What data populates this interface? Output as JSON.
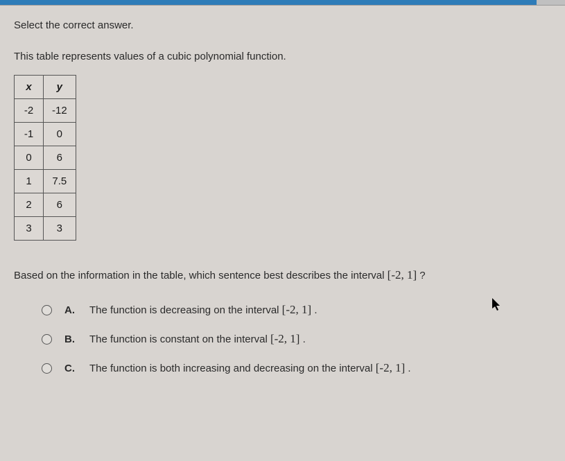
{
  "instruction": "Select the correct answer.",
  "description": "This table represents values of a cubic polynomial function.",
  "table": {
    "headers": {
      "x": "x",
      "y": "y"
    },
    "rows": [
      {
        "x": "-2",
        "y": "-12"
      },
      {
        "x": "-1",
        "y": "0"
      },
      {
        "x": "0",
        "y": "6"
      },
      {
        "x": "1",
        "y": "7.5"
      },
      {
        "x": "2",
        "y": "6"
      },
      {
        "x": "3",
        "y": "3"
      }
    ]
  },
  "question_prefix": "Based on the information in the table, which sentence best describes the interval ",
  "question_interval": "[-2, 1]",
  "question_suffix": " ?",
  "options": [
    {
      "label": "A.",
      "text_prefix": "The function is decreasing on the interval ",
      "interval": "[-2, 1]",
      "text_suffix": " ."
    },
    {
      "label": "B.",
      "text_prefix": "The function is constant on the interval ",
      "interval": "[-2, 1]",
      "text_suffix": " ."
    },
    {
      "label": "C.",
      "text_prefix": "The function is both increasing and decreasing on the interval ",
      "interval": "[-2, 1]",
      "text_suffix": " ."
    }
  ]
}
